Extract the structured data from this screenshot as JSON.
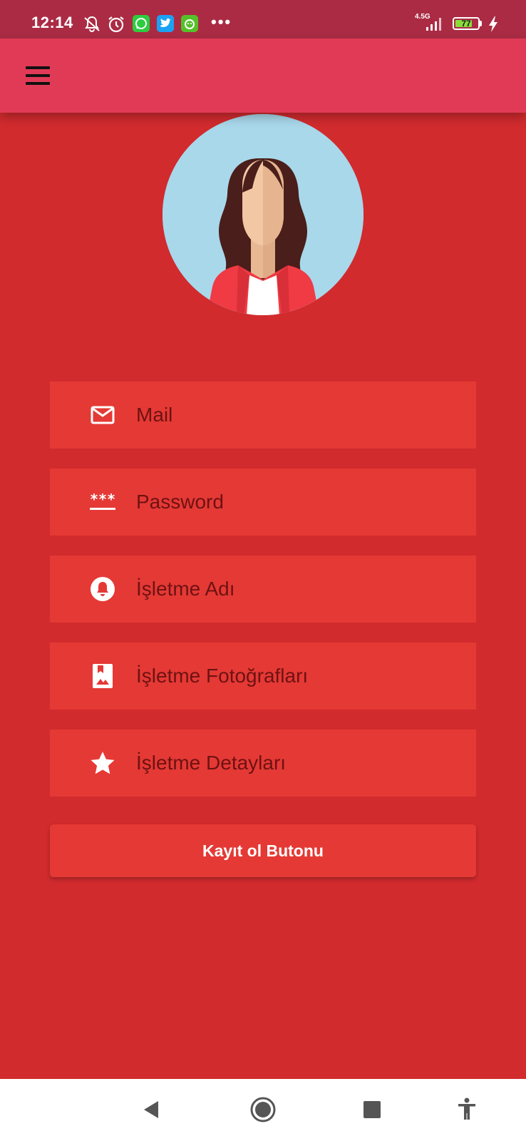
{
  "status_bar": {
    "time": "12:14",
    "network": "4.5G",
    "battery_level": "77",
    "battery_fraction": 0.77,
    "icons": [
      "bell-off-icon",
      "alarm-icon",
      "whatsapp-icon",
      "twitter-icon",
      "app-icon",
      "more-dots-icon",
      "signal-icon",
      "battery-icon",
      "charging-icon"
    ],
    "dots": "•••"
  },
  "app_bar": {
    "menu_icon": "hamburger-menu-icon"
  },
  "avatar": {
    "icon": "woman-avatar-icon"
  },
  "form": {
    "fields": [
      {
        "label": "Mail",
        "icon": "mail-icon"
      },
      {
        "label": "Password",
        "icon": "password-icon"
      },
      {
        "label": "İşletme Adı",
        "icon": "bell-icon"
      },
      {
        "label": "İşletme Fotoğrafları",
        "icon": "photo-bookmark-icon"
      },
      {
        "label": "İşletme Detayları",
        "icon": "star-icon"
      }
    ],
    "submit_label": "Kayıt ol Butonu"
  },
  "nav_bar": {
    "buttons": [
      "back-icon",
      "home-icon",
      "recents-icon",
      "accessibility-icon"
    ]
  },
  "colors": {
    "background": "#d12b2e",
    "status_bar": "#ab2b44",
    "app_bar": "#e13a56",
    "field": "#e53935",
    "field_text": "#6e1212"
  }
}
